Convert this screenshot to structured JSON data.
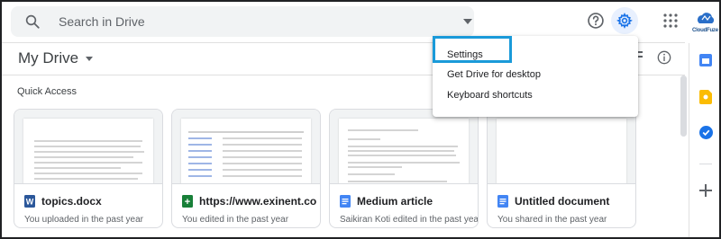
{
  "search": {
    "placeholder": "Search in Drive"
  },
  "header": {
    "title": "My Drive"
  },
  "brand": {
    "label": "CloudFuze"
  },
  "quick_access": {
    "label": "Quick Access",
    "cards": [
      {
        "name": "topics.docx",
        "subtitle": "You uploaded in the past year",
        "icon": "word-doc-icon",
        "icon_letter": "W"
      },
      {
        "name": "https://www.exinent.com/ ...",
        "subtitle": "You edited in the past year",
        "icon": "sheets-icon",
        "icon_letter": "+"
      },
      {
        "name": "Medium article",
        "subtitle": "Saikiran Koti edited in the past year",
        "icon": "docs-icon"
      },
      {
        "name": "Untitled document",
        "subtitle": "You shared in the past year",
        "icon": "docs-icon"
      }
    ]
  },
  "menu": {
    "items": [
      "Settings",
      "Get Drive for desktop",
      "Keyboard shortcuts"
    ],
    "highlighted": "Settings"
  },
  "colors": {
    "accent": "#1a73e8",
    "highlight_border": "#1a9ad9",
    "word_blue": "#2b579a",
    "sheets_green": "#188038",
    "docs_blue": "#4285f4"
  }
}
